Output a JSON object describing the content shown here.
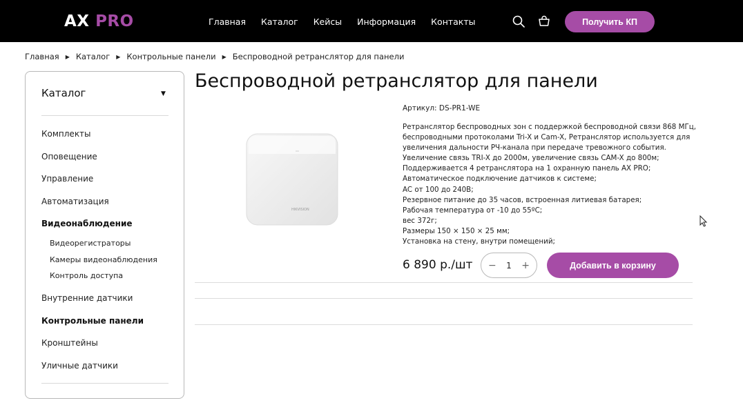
{
  "header": {
    "logo_ax": "AX",
    "logo_pro": "PRO",
    "nav": [
      "Главная",
      "Каталог",
      "Кейсы",
      "Информация",
      "Контакты"
    ],
    "search_icon": "search-icon",
    "cart_icon": "cart-icon",
    "cta_label": "Получить КП",
    "accent_color": "#a64ca6"
  },
  "breadcrumb": [
    "Главная",
    "Каталог",
    "Контрольные панели",
    "Беспроводной ретранслятор для панели"
  ],
  "sidebar": {
    "title": "Каталог",
    "items": [
      "Комплекты",
      "Оповещение",
      "Управление",
      "Автоматизация",
      "Видеонаблюдение",
      "Внутренние датчики",
      "Контрольные панели",
      "Кронштейны",
      "Уличные датчики"
    ],
    "subitems": [
      "Видеорегистраторы",
      "Камеры видеонаблюдения",
      "Контроль доступа"
    ]
  },
  "product": {
    "title": "Беспроводной ретранслятор для панели",
    "article": "Артикул: DS-PR1-WE",
    "image_brand": "HIKVISION",
    "description": [
      "Ретранслятор беспроводных зон с поддержкой беспроводной связи 868 МГц,",
      "беспроводными протоколами Tri-X и Cam-X, Ретранслятор используется для",
      "увеличения дальности РЧ-канала при передаче тревожного события.",
      "Увеличение связь TRI-X до 2000м, увеличение связь CAM-X до 800м;",
      "Поддерживается 4 ретранслятора на 1 охранную панель AX PRO;",
      "Автоматическое подключение датчиков к системе;",
      "AC от 100 до 240В;",
      "Резервное питание до 35 часов, встроенная литиевая батарея;",
      "Рабочая температура от -10 до 55ºC;",
      "вес 372г;",
      "Размеры 150 × 150 × 25 мм;",
      "Установка на стену, внутри помещений;"
    ],
    "price": "6 890 р./шт",
    "qty_minus": "−",
    "qty_value": "1",
    "qty_plus": "+",
    "add_to_cart": "Добавить в корзину"
  }
}
